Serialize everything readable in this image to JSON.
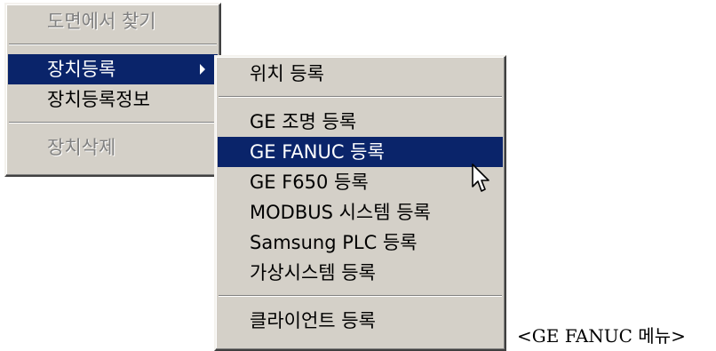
{
  "main_menu": {
    "items": [
      {
        "label": "도면에서 찾기",
        "state": "disabled"
      },
      {
        "label": "장치등록",
        "state": "selected",
        "has_submenu": true
      },
      {
        "label": "장치등록정보",
        "state": "normal"
      },
      {
        "label": "장치삭제",
        "state": "disabled"
      }
    ]
  },
  "sub_menu": {
    "items": [
      {
        "label": "위치 등록",
        "state": "normal"
      },
      {
        "label": "GE 조명 등록",
        "state": "normal"
      },
      {
        "label": "GE FANUC 등록",
        "state": "selected"
      },
      {
        "label": "GE F650 등록",
        "state": "normal"
      },
      {
        "label": "MODBUS 시스템 등록",
        "state": "normal"
      },
      {
        "label": "Samsung PLC 등록",
        "state": "normal"
      },
      {
        "label": "가상시스템 등록",
        "state": "normal"
      },
      {
        "label": "클라이언트 등록",
        "state": "normal"
      }
    ]
  },
  "caption": "<GE FANUC  메뉴>",
  "colors": {
    "menu_background": "#d4d0c8",
    "highlight": "#0a246a",
    "highlight_text": "#ffffff",
    "disabled_text": "#808080"
  },
  "icons": {
    "submenu_arrow": "triangle-right-icon",
    "cursor": "mouse-pointer-icon"
  }
}
